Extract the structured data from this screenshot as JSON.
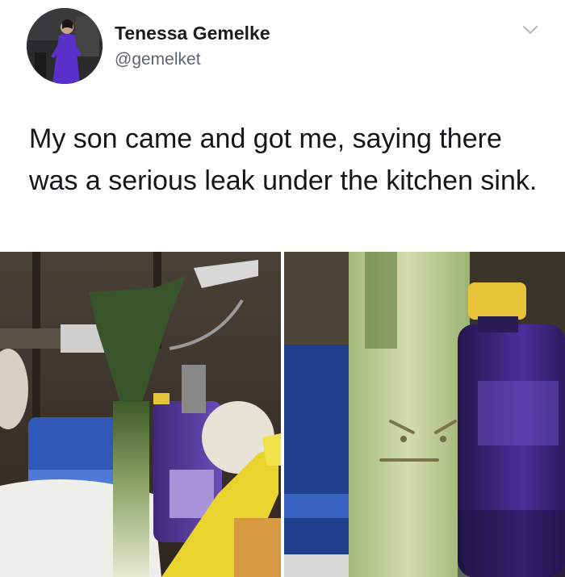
{
  "tweet": {
    "author_name": "Tenessa Gemelke",
    "author_handle": "@gemelket",
    "text": "My son came and got me, saying there was a serious leak under the kitchen sink."
  },
  "icons": {
    "menu": "chevron-down-icon"
  },
  "colors": {
    "background": "#ffffff",
    "text": "#14171a",
    "handle": "#5b6670",
    "chevron": "#b0b8c0"
  }
}
